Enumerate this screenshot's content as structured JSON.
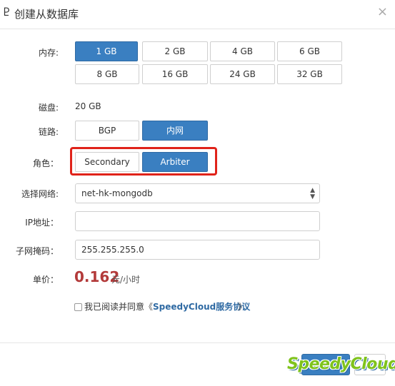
{
  "dialog": {
    "title": "创建从数据库",
    "title_icon_glyph": "Ⴒ",
    "close_glyph": "×"
  },
  "memory": {
    "label": "内存:",
    "options": [
      "1 GB",
      "2 GB",
      "4 GB",
      "6 GB",
      "8 GB",
      "16 GB",
      "24 GB",
      "32 GB"
    ],
    "selected": "1 GB"
  },
  "disk": {
    "label": "磁盘:",
    "value": "20 GB"
  },
  "link": {
    "label": "链路:",
    "options": [
      "BGP",
      "内网"
    ],
    "selected": "内网"
  },
  "role": {
    "label": "角色：",
    "options": [
      "Secondary",
      "Arbiter"
    ],
    "selected": "Arbiter"
  },
  "network": {
    "label": "选择网络:",
    "value": "net-hk-mongodb",
    "arrow_glyph": "▲▼"
  },
  "ip": {
    "label": "IP地址：",
    "value": ""
  },
  "subnet": {
    "label": "子网掩码：",
    "value": "255.255.255.0"
  },
  "price": {
    "label": "单价：",
    "value": "0.162",
    "unit": "元/小时"
  },
  "agreement": {
    "text": "我已阅读并同意",
    "open_quote": "《",
    "link_text": "SpeedyCloud服务协议",
    "close_quote": "》",
    "checked": false
  },
  "footer": {
    "primary_label": "",
    "secondary_label": "",
    "watermark": "SpeedyCloud®"
  },
  "colors": {
    "accent": "#3a7fc1",
    "highlight_border": "#e0231a",
    "price": "#b33a3a",
    "link": "#2f6aa3",
    "watermark": "#7fc31c"
  }
}
